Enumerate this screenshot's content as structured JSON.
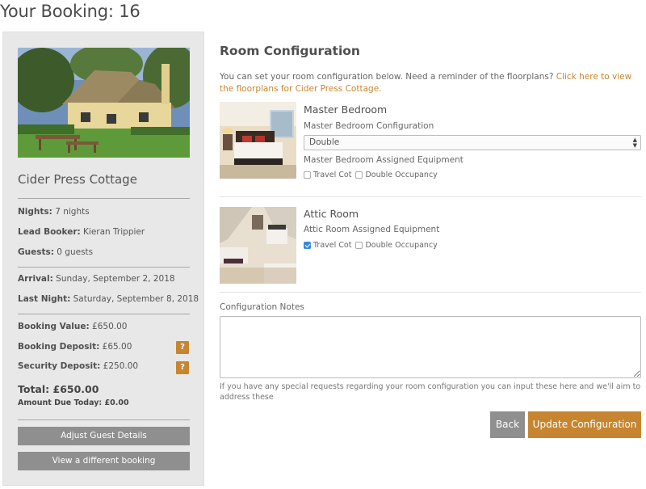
{
  "page": {
    "title": "Your Booking: 16"
  },
  "sidebar": {
    "property_name": "Cider Press Cottage",
    "nights_label": "Nights:",
    "nights_value": "7 nights",
    "lead_booker_label": "Lead Booker:",
    "lead_booker_value": "Kieran Trippier",
    "guests_label": "Guests:",
    "guests_value": "0 guests",
    "arrival_label": "Arrival:",
    "arrival_value": "Sunday, September 2, 2018",
    "last_night_label": "Last Night:",
    "last_night_value": "Saturday, September 8, 2018",
    "booking_value_label": "Booking Value:",
    "booking_value_value": "£650.00",
    "booking_deposit_label": "Booking Deposit:",
    "booking_deposit_value": "£65.00",
    "security_deposit_label": "Security Deposit:",
    "security_deposit_value": "£250.00",
    "help_label": "?",
    "total": "Total: £650.00",
    "amount_due": "Amount Due Today: £0.00",
    "adjust_button": "Adjust Guest Details",
    "view_booking_button": "View a different booking"
  },
  "main": {
    "section_title": "Room Configuration",
    "intro_text": "You can set your room configuration below. Need a reminder of the floorplans?",
    "intro_link": "Click here to view the floorplans for Cider Press Cottage.",
    "rooms": [
      {
        "name": "Master Bedroom",
        "config_label": "Master Bedroom Configuration",
        "config_value": "Double",
        "equipment_label": "Master Bedroom Assigned Equipment",
        "options": [
          {
            "label": "Travel Cot",
            "checked": false
          },
          {
            "label": "Double Occupancy",
            "checked": false
          }
        ]
      },
      {
        "name": "Attic Room",
        "equipment_label": "Attic Room Assigned Equipment",
        "options": [
          {
            "label": "Travel Cot",
            "checked": true
          },
          {
            "label": "Double Occupancy",
            "checked": false
          }
        ]
      }
    ],
    "notes_label": "Configuration Notes",
    "notes_value": "",
    "notes_help": "If you have any special requests regarding your room configuration you can input these here and we'll aim to address these",
    "back_button": "Back",
    "update_button": "Update Configuration"
  },
  "colors": {
    "accent": "#c7852f",
    "button_grey": "#8f8f8f",
    "sidebar_bg": "#e8e8e8",
    "checkbox_checked": "#3a86e5"
  }
}
